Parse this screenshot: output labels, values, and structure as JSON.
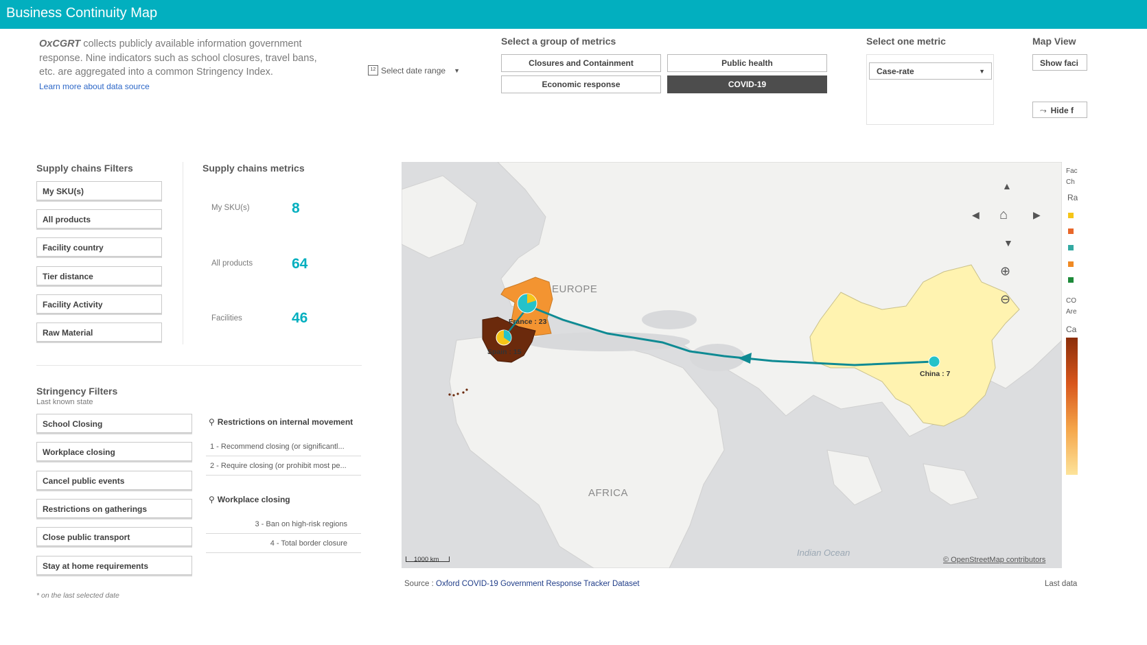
{
  "header": {
    "title": "Business Continuity Map"
  },
  "intro": {
    "brand": "OxCGRT",
    "text": " collects publicly available information government response. Nine indicators such as school closures, travel bans, etc. are aggregated into a common Stringency Index.",
    "learn_more": "Learn more about data source"
  },
  "date_picker": {
    "icon": "calendar-icon",
    "label": "Select date range"
  },
  "metric_groups": {
    "title": "Select a group of metrics",
    "buttons": [
      "Closures and Containment",
      "Public health",
      "Economic response",
      "COVID-19"
    ],
    "selected": "COVID-19"
  },
  "one_metric": {
    "title": "Select one metric",
    "value": "Case-rate"
  },
  "map_view": {
    "title": "Map View",
    "show_button": "Show faci",
    "hide_button": "Hide f"
  },
  "supply_filters": {
    "title": "Supply chains Filters",
    "items": [
      "My SKU(s)",
      "All products",
      "Facility country",
      "Tier distance",
      "Facility Activity",
      "Raw Material"
    ]
  },
  "supply_metrics": {
    "title": "Supply chains metrics",
    "items": [
      {
        "label": "My SKU(s)",
        "value": "8"
      },
      {
        "label": "All products",
        "value": "64"
      },
      {
        "label": "Facilities",
        "value": "46"
      }
    ]
  },
  "stringency": {
    "title": "Stringency Filters",
    "subtitle": "Last known state",
    "items": [
      "School Closing",
      "Workplace closing",
      "Cancel public events",
      "Restrictions on gatherings",
      "Close public transport",
      "Stay at home requirements"
    ],
    "footnote": "* on the last selected date"
  },
  "lists": {
    "internal_movement": {
      "title": "Restrictions on internal movement",
      "rows": [
        "1 - Recommend closing (or significantl...",
        "2 - Require closing (or prohibit most pe..."
      ]
    },
    "workplace": {
      "title": "Workplace closing",
      "rows": [
        "3 - Ban on high-risk regions",
        "4 - Total border closure"
      ]
    }
  },
  "map": {
    "labels": {
      "europe": "EUROPE",
      "africa": "AFRICA",
      "ocean": "Indian Ocean"
    },
    "markers": [
      "France : 23",
      "Spain : 15",
      "China : 7"
    ],
    "scale": "1000 km",
    "attribution": "© OpenStreetMap contributors",
    "colors": {
      "route": "#0e8a93",
      "france": "#f39431",
      "spain": "#6b2a0c",
      "china": "#fff3b0",
      "marker": "#25c2c9"
    }
  },
  "legend": {
    "labels": [
      "Fac",
      "Ch",
      "Ra",
      "CO",
      "Are",
      "Ca"
    ],
    "swatches": [
      "#f5c518",
      "#e8672a",
      "#33a9a2",
      "#f08a24",
      "#1e8a3a"
    ]
  },
  "footer": {
    "source_prefix": "Source : ",
    "source_link": "Oxford COVID-19 Government Response Tracker Dataset",
    "last": "Last data"
  }
}
